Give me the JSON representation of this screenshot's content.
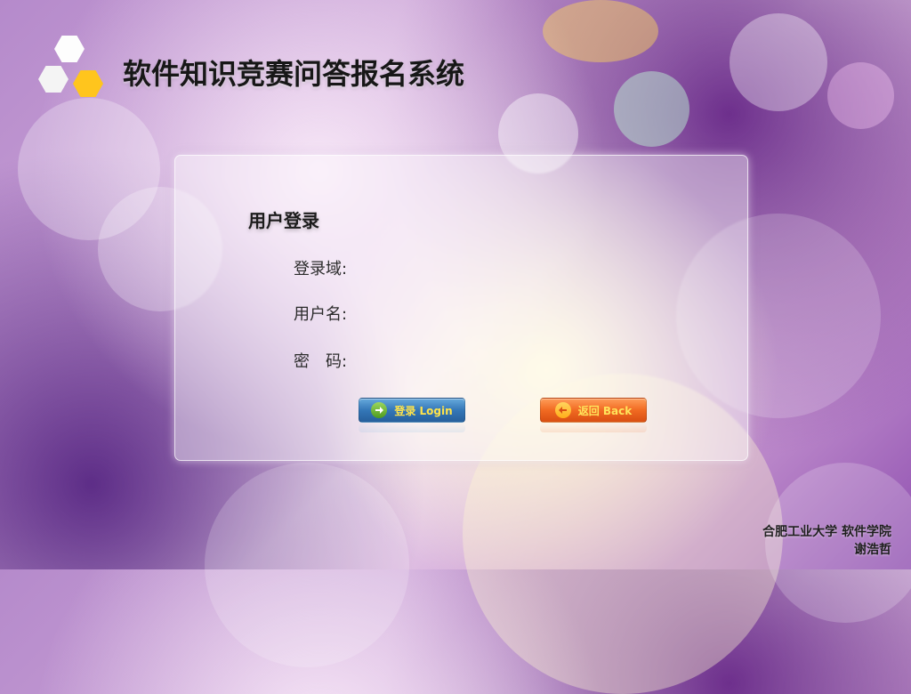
{
  "header": {
    "title": "软件知识竞赛问答报名系统"
  },
  "login_panel": {
    "title": "用户登录",
    "fields": [
      {
        "label": "登录域:",
        "value": ""
      },
      {
        "label": "用户名:",
        "value": ""
      },
      {
        "label": "密　码:",
        "value": ""
      }
    ],
    "buttons": {
      "login": "登录 Login",
      "back": "返回 Back"
    }
  },
  "footer": {
    "line1": "合肥工业大学 软件学院",
    "line2": "谢浩哲"
  },
  "icons": {
    "brand": "hexagon-logo-icon",
    "login": "green-arrow-right-icon",
    "back": "yellow-arrow-left-icon"
  },
  "colors": {
    "login_button": "#3477b7",
    "back_button": "#f16a22",
    "logo_accent": "#ffc51d"
  }
}
